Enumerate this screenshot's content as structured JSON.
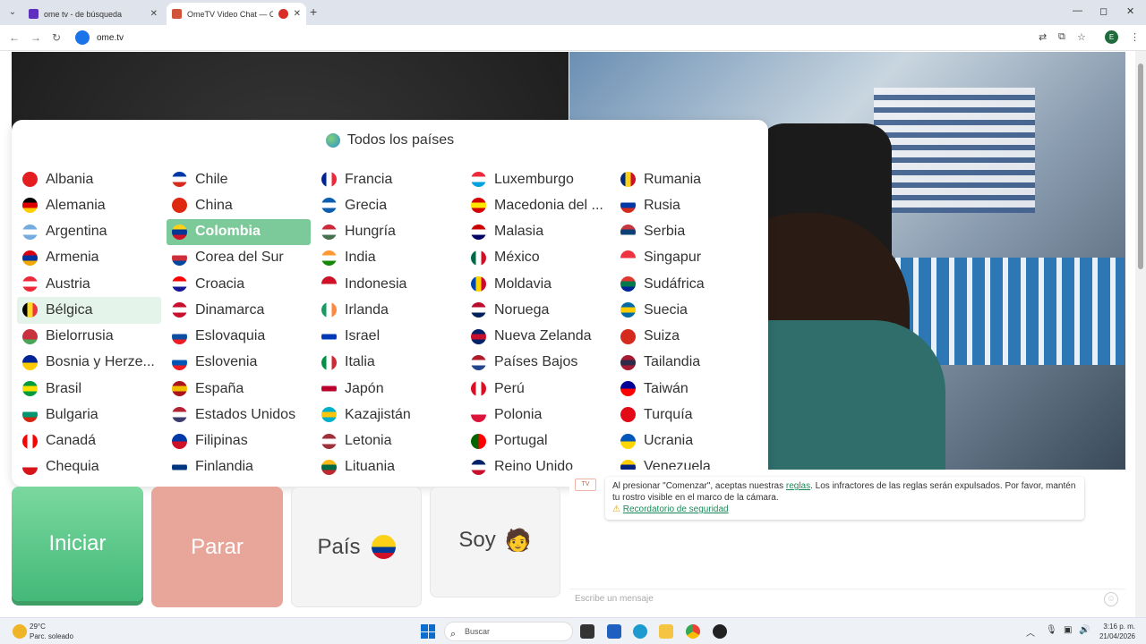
{
  "browser": {
    "tabs": [
      {
        "title": "ome tv - de búsqueda",
        "favicon_color": "#5f2fbf"
      },
      {
        "title": "OmeTV Video Chat — Ome",
        "favicon_color": "#d2553b"
      }
    ],
    "new_tab": "+",
    "close_glyph": "✕",
    "url": "ome.tv",
    "profile_initial": "E",
    "window_controls": {
      "minimize": "—",
      "maximize": "◻",
      "close": "✕"
    }
  },
  "popup": {
    "title": "Todos los países",
    "selected": "Colombia",
    "hovered": "Bélgica",
    "countries": [
      {
        "name": "Albania",
        "flag": [
          "#e41e20",
          "#e41e20"
        ]
      },
      {
        "name": "Alemania",
        "flag": [
          "#000000",
          "#dd0000",
          "#ffce00"
        ]
      },
      {
        "name": "Argentina",
        "flag": [
          "#74acdf",
          "#ffffff",
          "#74acdf"
        ]
      },
      {
        "name": "Armenia",
        "flag": [
          "#d90012",
          "#0033a0",
          "#f2a800"
        ]
      },
      {
        "name": "Austria",
        "flag": [
          "#ed2939",
          "#ffffff",
          "#ed2939"
        ]
      },
      {
        "name": "Bélgica",
        "flag": [
          "#000000",
          "#fdda24",
          "#ef3340"
        ],
        "dir": "v"
      },
      {
        "name": "Bielorrusia",
        "flag": [
          "#c8313e",
          "#c8313e",
          "#4aa657"
        ]
      },
      {
        "name": "Bosnia y Herze...",
        "flag": [
          "#002395",
          "#fecb00"
        ]
      },
      {
        "name": "Brasil",
        "flag": [
          "#009c3b",
          "#ffdf00",
          "#009c3b"
        ]
      },
      {
        "name": "Bulgaria",
        "flag": [
          "#ffffff",
          "#00966e",
          "#d62612"
        ]
      },
      {
        "name": "Canadá",
        "flag": [
          "#ff0000",
          "#ffffff",
          "#ff0000"
        ],
        "dir": "v"
      },
      {
        "name": "Chequia",
        "flag": [
          "#ffffff",
          "#d7141a"
        ]
      },
      {
        "name": "Chile",
        "flag": [
          "#0039a6",
          "#ffffff",
          "#d52b1e"
        ]
      },
      {
        "name": "China",
        "flag": [
          "#de2910",
          "#de2910"
        ]
      },
      {
        "name": "Colombia",
        "flag": [
          "#fcd116",
          "#003893",
          "#ce1126"
        ]
      },
      {
        "name": "Corea del Sur",
        "flag": [
          "#ffffff",
          "#cd2e3a",
          "#0047a0"
        ]
      },
      {
        "name": "Croacia",
        "flag": [
          "#ff0000",
          "#ffffff",
          "#171796"
        ]
      },
      {
        "name": "Dinamarca",
        "flag": [
          "#c8102e",
          "#ffffff",
          "#c8102e"
        ]
      },
      {
        "name": "Eslovaquia",
        "flag": [
          "#ffffff",
          "#0b4ea2",
          "#ee1c25"
        ]
      },
      {
        "name": "Eslovenia",
        "flag": [
          "#ffffff",
          "#0057b8",
          "#ed1c24"
        ]
      },
      {
        "name": "España",
        "flag": [
          "#aa151b",
          "#f1bf00",
          "#aa151b"
        ]
      },
      {
        "name": "Estados Unidos",
        "flag": [
          "#b22234",
          "#ffffff",
          "#3c3b6e"
        ]
      },
      {
        "name": "Filipinas",
        "flag": [
          "#0038a8",
          "#ce1126"
        ]
      },
      {
        "name": "Finlandia",
        "flag": [
          "#ffffff",
          "#003580",
          "#ffffff"
        ]
      },
      {
        "name": "Francia",
        "flag": [
          "#002395",
          "#ffffff",
          "#ed2939"
        ],
        "dir": "v"
      },
      {
        "name": "Grecia",
        "flag": [
          "#0d5eaf",
          "#ffffff",
          "#0d5eaf"
        ]
      },
      {
        "name": "Hungría",
        "flag": [
          "#ce2939",
          "#ffffff",
          "#477050"
        ]
      },
      {
        "name": "India",
        "flag": [
          "#ff9933",
          "#ffffff",
          "#138808"
        ]
      },
      {
        "name": "Indonesia",
        "flag": [
          "#ce1126",
          "#ffffff"
        ]
      },
      {
        "name": "Irlanda",
        "flag": [
          "#169b62",
          "#ffffff",
          "#ff883e"
        ],
        "dir": "v"
      },
      {
        "name": "Israel",
        "flag": [
          "#ffffff",
          "#0038b8",
          "#ffffff"
        ]
      },
      {
        "name": "Italia",
        "flag": [
          "#009246",
          "#ffffff",
          "#ce2b37"
        ],
        "dir": "v"
      },
      {
        "name": "Japón",
        "flag": [
          "#ffffff",
          "#bc002d",
          "#ffffff"
        ]
      },
      {
        "name": "Kazajistán",
        "flag": [
          "#00afca",
          "#fec50c",
          "#00afca"
        ]
      },
      {
        "name": "Letonia",
        "flag": [
          "#9e3039",
          "#ffffff",
          "#9e3039"
        ]
      },
      {
        "name": "Lituania",
        "flag": [
          "#fdb913",
          "#006a44",
          "#c1272d"
        ]
      },
      {
        "name": "Luxemburgo",
        "flag": [
          "#ed2939",
          "#ffffff",
          "#00a1de"
        ]
      },
      {
        "name": "Macedonia del ...",
        "flag": [
          "#d20000",
          "#ffe600",
          "#d20000"
        ]
      },
      {
        "name": "Malasia",
        "flag": [
          "#cc0001",
          "#ffffff",
          "#010066"
        ]
      },
      {
        "name": "México",
        "flag": [
          "#006847",
          "#ffffff",
          "#ce1126"
        ],
        "dir": "v"
      },
      {
        "name": "Moldavia",
        "flag": [
          "#0046ae",
          "#ffd200",
          "#cc092f"
        ],
        "dir": "v"
      },
      {
        "name": "Noruega",
        "flag": [
          "#ba0c2f",
          "#ffffff",
          "#00205b"
        ]
      },
      {
        "name": "Nueva Zelanda",
        "flag": [
          "#012169",
          "#c8102e",
          "#012169"
        ]
      },
      {
        "name": "Países Bajos",
        "flag": [
          "#ae1c28",
          "#ffffff",
          "#21468b"
        ]
      },
      {
        "name": "Perú",
        "flag": [
          "#d91023",
          "#ffffff",
          "#d91023"
        ],
        "dir": "v"
      },
      {
        "name": "Polonia",
        "flag": [
          "#ffffff",
          "#dc143c"
        ]
      },
      {
        "name": "Portugal",
        "flag": [
          "#006600",
          "#ff0000"
        ],
        "dir": "v"
      },
      {
        "name": "Reino Unido",
        "flag": [
          "#012169",
          "#ffffff",
          "#c8102e"
        ]
      },
      {
        "name": "Rumania",
        "flag": [
          "#002b7f",
          "#fcd116",
          "#ce1126"
        ],
        "dir": "v"
      },
      {
        "name": "Rusia",
        "flag": [
          "#ffffff",
          "#0039a6",
          "#d52b1e"
        ]
      },
      {
        "name": "Serbia",
        "flag": [
          "#c6363c",
          "#0c4076",
          "#ffffff"
        ]
      },
      {
        "name": "Singapur",
        "flag": [
          "#ef3340",
          "#ffffff"
        ]
      },
      {
        "name": "Sudáfrica",
        "flag": [
          "#de3831",
          "#007a4d",
          "#002395"
        ]
      },
      {
        "name": "Suecia",
        "flag": [
          "#006aa7",
          "#fecc00",
          "#006aa7"
        ]
      },
      {
        "name": "Suiza",
        "flag": [
          "#d52b1e",
          "#d52b1e"
        ]
      },
      {
        "name": "Tailandia",
        "flag": [
          "#a51931",
          "#2d2a4a",
          "#a51931"
        ]
      },
      {
        "name": "Taiwán",
        "flag": [
          "#000095",
          "#fe0000"
        ]
      },
      {
        "name": "Turquía",
        "flag": [
          "#e30a17",
          "#e30a17"
        ]
      },
      {
        "name": "Ucrania",
        "flag": [
          "#0057b7",
          "#ffd700"
        ]
      },
      {
        "name": "Venezuela",
        "flag": [
          "#ffcc00",
          "#00247d",
          "#cf142b"
        ]
      }
    ]
  },
  "controls": {
    "start": "Iniciar",
    "stop": "Parar",
    "country": "País",
    "me": "Soy",
    "me_emoji": "🧑"
  },
  "chat": {
    "avatar_label": "TV",
    "message_before_link": "Al presionar \"Comenzar\", aceptas nuestras ",
    "rules_link": "reglas",
    "message_after_link": ". Los infractores de las reglas serán expulsados. Por favor, mantén tu rostro visible en el marco de la cámara.",
    "warning_glyph": "⚠",
    "safety_link": "Recordatorio de seguridad",
    "input_placeholder": "Escribe un mensaje",
    "emoji_glyph": "☺"
  },
  "taskbar": {
    "temperature": "29°C",
    "weather": "Parc. soleado",
    "search": "Buscar",
    "time": "3:16 p. m.",
    "date": "21/04/2026"
  }
}
